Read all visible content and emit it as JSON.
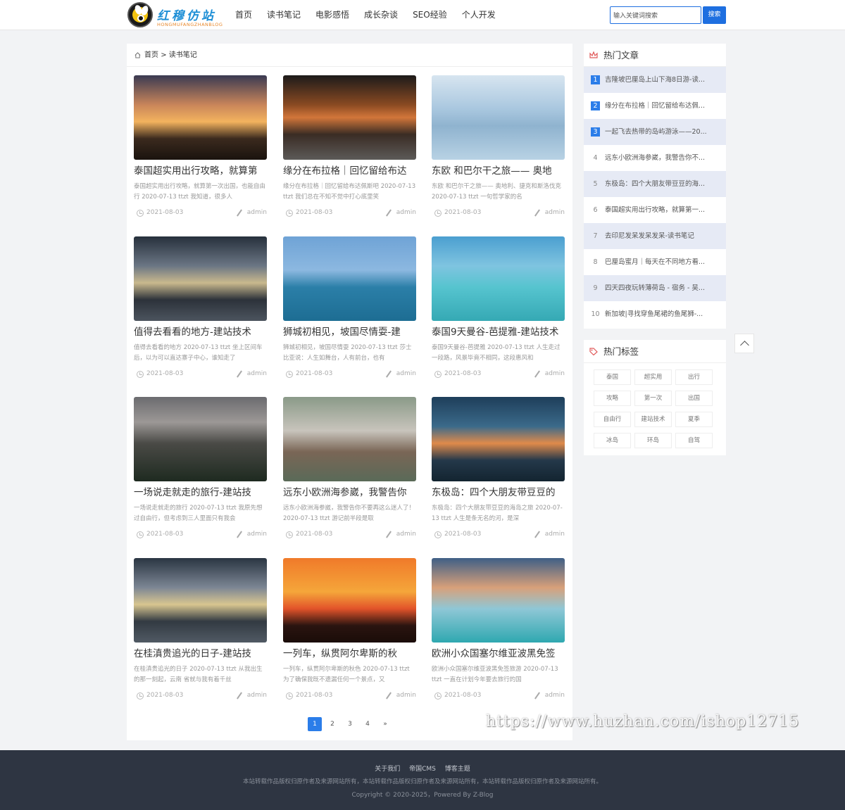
{
  "header": {
    "logo_title": "红穆仿站",
    "logo_sub": "HONGMUFANGZHANBLOG",
    "nav": [
      "首页",
      "读书笔记",
      "电影感悟",
      "成长杂谈",
      "SEO经验",
      "个人开发"
    ],
    "search_placeholder": "输入关键词搜索",
    "search_button": "搜索"
  },
  "breadcrumb": {
    "home": "首页",
    "sep": ">",
    "current": "读书笔记"
  },
  "posts": [
    {
      "title": "泰国超实用出行攻略，就算第",
      "desc": "泰国超实用出行攻略，就算第一次出国，也能自由行 2020-07-13 ttzt 我知道，很多人",
      "date": "2021-08-03",
      "author": "admin",
      "image": "sunset-lake-forest"
    },
    {
      "title": "缘分在布拉格｜回忆留给布达",
      "desc": "缘分在布拉格｜回忆留给布达佩斯吧 2020-07-13 ttzt 我们总在不知不觉中打心底里笑",
      "date": "2021-08-03",
      "author": "admin",
      "image": "railway-autumn"
    },
    {
      "title": "东欧 和巴尔干之旅—— 奥地",
      "desc": "东欧 和巴尔干之旅—— 奥地利、捷克和斯洛伐克 2020-07-13 ttzt 一句哲学家的名",
      "date": "2021-08-03",
      "author": "admin",
      "image": "sailboat-lake"
    },
    {
      "title": "值得去看看的地方-建站技术",
      "desc": "值得去看看的地方 2020-07-13 ttzt 坐上区间车后，以为可以直达寨子中心，谁知走了",
      "date": "2021-08-03",
      "author": "admin",
      "image": "airplane-dusk"
    },
    {
      "title": "狮城初相见，坡国尽情耍-建",
      "desc": "狮城初相见，坡国尽情耍 2020-07-13 ttzt 莎士比亚说：人生如舞台，人有前台，也有",
      "date": "2021-08-03",
      "author": "admin",
      "image": "golden-gate-bridge"
    },
    {
      "title": "泰国9天曼谷-芭提雅-建站技术",
      "desc": "泰国9天曼谷-芭提雅 2020-07-13 ttzt 人生走过一段路，风景毕竟不相同，这段惠风和",
      "date": "2021-08-03",
      "author": "admin",
      "image": "overwater-bungalow"
    },
    {
      "title": "一场说走就走的旅行-建站技",
      "desc": "一场说走就走的旅行 2020-07-13 ttzt 我原先想过自由行，但考虑到三人里面只有我会",
      "date": "2021-08-03",
      "author": "admin",
      "image": "mountain-fog"
    },
    {
      "title": "远东小欧洲海参崴，我警告你",
      "desc": "远东小欧洲海参崴，我警告你不要再这么迷人了！ 2020-07-13 ttzt 游记前半段是取",
      "date": "2021-08-03",
      "author": "admin",
      "image": "girl-woods"
    },
    {
      "title": "东极岛：四个大朋友带豆豆的",
      "desc": "东极岛：四个大朋友带豆豆的海岛之旅 2020-07-13 ttzt 人生是条无名的河，是深",
      "date": "2021-08-03",
      "author": "admin",
      "image": "sunset-islands"
    },
    {
      "title": "在桂滇贵追光的日子-建站技",
      "desc": "在桂滇贵追光的日子 2020-07-13 ttzt 从我出生的那一刻起，云南 省就与我有着千丝",
      "date": "2021-08-03",
      "author": "admin",
      "image": "airplane-dusk-2"
    },
    {
      "title": "一列车，纵贯阿尔卑斯的秋",
      "desc": "一列车，纵贯阿尔卑斯的秋色 2020-07-13 ttzt 为了确保我既不遗漏任何一个景点，又",
      "date": "2021-08-03",
      "author": "admin",
      "image": "jumping-silhouettes"
    },
    {
      "title": "欧洲小众国塞尔维亚波黑免签",
      "desc": "欧洲小众国塞尔维亚波黑免签旅游 2020-07-13 ttzt 一直在计划今年要去旅行的国",
      "date": "2021-08-03",
      "author": "admin",
      "image": "beach-couple"
    }
  ],
  "pagination": [
    "1",
    "2",
    "3",
    "4",
    "»"
  ],
  "hot_articles": {
    "title": "热门文章",
    "items": [
      "吉隆坡巴厘岛上山下海8日游-读...",
      "缘分在布拉格｜回忆留给布达佩...",
      "一起飞去热带的岛屿游泳——20...",
      "远东小欧洲海参崴，我警告你不...",
      "东极岛：四个大朋友带豆豆的海...",
      "泰国超实用出行攻略，就算第一...",
      "去印尼发呆发呆发呆-读书笔记",
      "巴厘岛蜜月｜每天在不同地方看...",
      "四天四夜玩转薄荷岛 - 宿务 - 吴...",
      "新加坡|寻找穿鱼尾裙的鱼尾狮-..."
    ]
  },
  "hot_tags": {
    "title": "热门标签",
    "items": [
      "泰国",
      "超实用",
      "出行",
      "攻略",
      "第一次",
      "出国",
      "自由行",
      "建站技术",
      "夏季",
      "冰岛",
      "环岛",
      "自驾"
    ]
  },
  "footer": {
    "links": [
      "关于我们",
      "帝国CMS",
      "博客主题"
    ],
    "note": "本站转载作品版权归原作者及来源网站所有，本站转载作品版权归原作者及来源网站所有，本站转载作品版权归原作者及来源网站所有。",
    "copyright": "Copyright © 2020-2025，Powered By Z-Blog"
  },
  "watermark": "https://www.huzhan.com/ishop12715",
  "colors": {
    "accent": "#2b7de9",
    "footer_bg": "#2e3542",
    "hot_row_shade": "#e6eaf5",
    "logo_blue": "#1e8fd6"
  }
}
